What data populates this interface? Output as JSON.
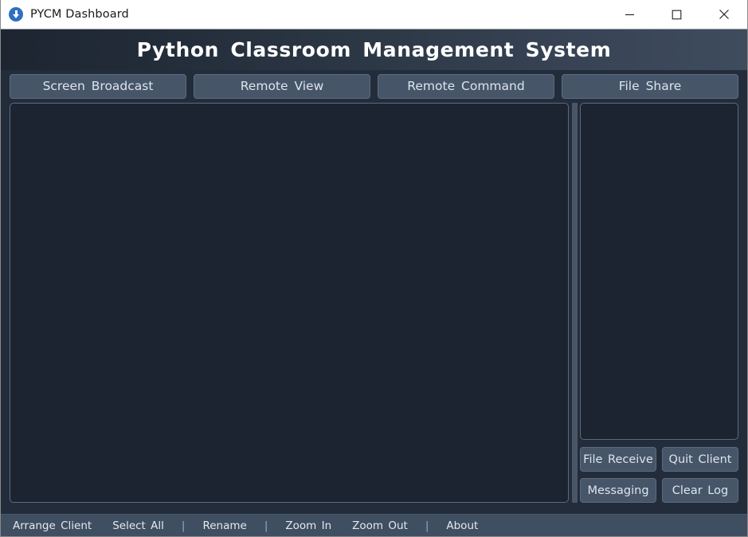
{
  "window": {
    "title": "PYCM Dashboard",
    "icon": "download-circle-icon",
    "controls": {
      "minimize": "minimize-icon",
      "maximize": "maximize-icon",
      "close": "close-icon"
    }
  },
  "header": {
    "title": "Python  Classroom  Management  System"
  },
  "tabs": [
    {
      "label": "Screen  Broadcast"
    },
    {
      "label": "Remote  View"
    },
    {
      "label": "Remote  Command"
    },
    {
      "label": "File  Share"
    }
  ],
  "main": {
    "client_area_placeholder": "",
    "log_area_placeholder": ""
  },
  "side_buttons": [
    {
      "label": "File  Receive"
    },
    {
      "label": "Quit  Client"
    },
    {
      "label": "Messaging"
    },
    {
      "label": "Clear  Log"
    }
  ],
  "statusbar": {
    "items": [
      {
        "label": "Arrange  Client"
      },
      {
        "label": "Select  All"
      },
      {
        "label": "Rename"
      },
      {
        "label": "Zoom  In"
      },
      {
        "label": "Zoom  Out"
      },
      {
        "label": "About"
      }
    ],
    "separator": "|"
  },
  "colors": {
    "window_bg": "#232c3a",
    "header_gradient_start": "#1d2531",
    "header_gradient_end": "#3f4c5e",
    "panel_bg": "#1b2430",
    "panel_border": "#5e6b7c",
    "button_bg": "#475569",
    "button_border": "#5c6b80",
    "button_text": "#dde4ec",
    "statusbar_bg": "#3f4e60",
    "statusbar_text": "#e3e9f0",
    "titlebar_bg": "#ffffff",
    "titlebar_text": "#1a1a1a",
    "icon_blue": "#2f6fc0",
    "splitter": "#4a5668"
  }
}
